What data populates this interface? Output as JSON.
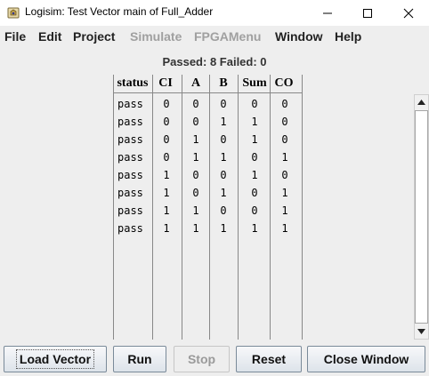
{
  "window": {
    "title": "Logisim: Test Vector main of Full_Adder"
  },
  "menu": [
    "File",
    "Edit",
    "Project",
    "Simulate",
    "FPGAMenu",
    "Window",
    "Help"
  ],
  "summary": "Passed: 8 Failed: 0",
  "table": {
    "columns": [
      "status",
      "CI",
      "A",
      "B",
      "Sum",
      "CO"
    ],
    "rows": [
      [
        "pass",
        "0",
        "0",
        "0",
        "0",
        "0"
      ],
      [
        "pass",
        "0",
        "0",
        "1",
        "1",
        "0"
      ],
      [
        "pass",
        "0",
        "1",
        "0",
        "1",
        "0"
      ],
      [
        "pass",
        "0",
        "1",
        "1",
        "0",
        "1"
      ],
      [
        "pass",
        "1",
        "0",
        "0",
        "1",
        "0"
      ],
      [
        "pass",
        "1",
        "0",
        "1",
        "0",
        "1"
      ],
      [
        "pass",
        "1",
        "1",
        "0",
        "0",
        "1"
      ],
      [
        "pass",
        "1",
        "1",
        "1",
        "1",
        "1"
      ]
    ]
  },
  "buttons": {
    "load_vector": "Load Vector",
    "run": "Run",
    "stop": "Stop",
    "reset": "Reset",
    "close_window": "Close Window"
  }
}
